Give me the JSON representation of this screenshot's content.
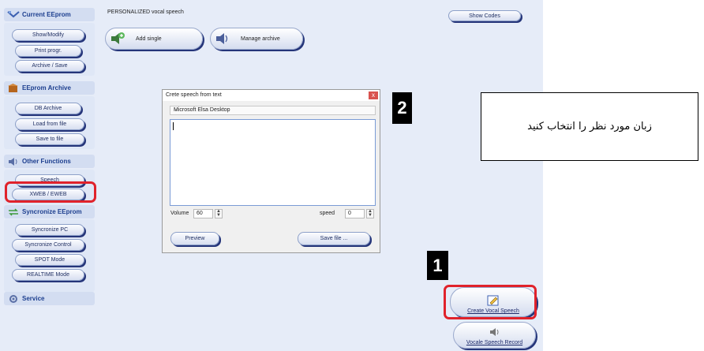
{
  "header": {
    "title": "PERSONALIZED vocal speech",
    "show_codes": "Show Codes"
  },
  "sidebar": {
    "current_eeprom": {
      "title": "Current EEprom",
      "items": [
        "Show/Modify",
        "Print progr.",
        "Archive / Save"
      ]
    },
    "eeprom_archive": {
      "title": "EEprom Archive",
      "items": [
        "DB Archive",
        "Load from file",
        "Save to file"
      ]
    },
    "other_functions": {
      "title": "Other Functions",
      "items": [
        "Speech",
        "XWEB / EWEB"
      ]
    },
    "synchronize": {
      "title": "Syncronize EEprom",
      "items": [
        "Syncronize PC",
        "Syncronize Control",
        "SPOT Mode",
        "REALTIME Mode"
      ]
    },
    "service": {
      "title": "Service"
    }
  },
  "toolbar": {
    "add_single": "Add single",
    "manage_archive": "Manage archive"
  },
  "dialog": {
    "title": "Crete speech from text",
    "close": "x",
    "voice": "Microsoft Elsa Desktop",
    "text": "",
    "volume_label": "Volume",
    "volume_value": "60",
    "speed_label": "speed",
    "speed_value": "0",
    "preview": "Preview",
    "save_file": "Save file ..."
  },
  "bottom_right": {
    "create_vocal_speech": "Create Vocal Speech",
    "vocal_speech_record": "Vocale Speech Record"
  },
  "annotations": {
    "step1": "1",
    "step2": "2",
    "callout": "زبان مورد نظر را انتخاب کنید",
    "highlight_color": "#e0222b"
  },
  "colors": {
    "app_bg": "#e6ecf8",
    "section_text": "#1d3f8f",
    "button_shadow": "#25357a"
  }
}
